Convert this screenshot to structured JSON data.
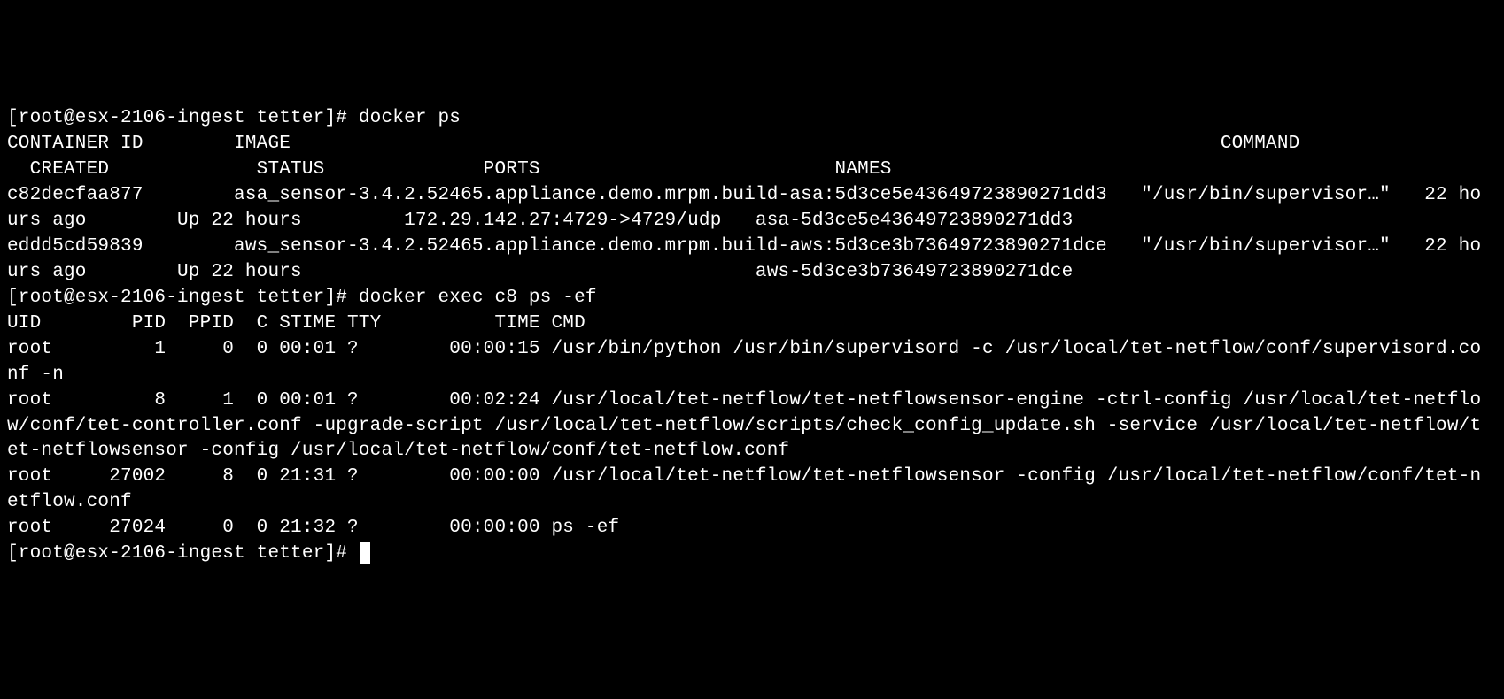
{
  "terminal": {
    "prompt1_open": "[",
    "prompt1_text": "[root@esx-2106-ingest tetter]# ",
    "cmd1": "docker ps",
    "header_line": "CONTAINER ID        IMAGE                                                                                  COMMAND                  CREATED             STATUS              PORTS                          NAMES",
    "row1": "c82decfaa877        asa_sensor-3.4.2.52465.appliance.demo.mrpm.build-asa:5d3ce5e43649723890271dd3   \"/usr/bin/supervisor…\"   22 hours ago        Up 22 hours         172.29.142.27:4729->4729/udp   asa-5d3ce5e43649723890271dd3",
    "row2": "eddd5cd59839        aws_sensor-3.4.2.52465.appliance.demo.mrpm.build-aws:5d3ce3b73649723890271dce   \"/usr/bin/supervisor…\"   22 hours ago        Up 22 hours                                        aws-5d3ce3b73649723890271dce",
    "prompt2_text": "[root@esx-2106-ingest tetter]# ",
    "cmd2": "docker exec c8 ps -ef",
    "ps_header": "UID        PID  PPID  C STIME TTY          TIME CMD",
    "ps_row1": "root         1     0  0 00:01 ?        00:00:15 /usr/bin/python /usr/bin/supervisord -c /usr/local/tet-netflow/conf/supervisord.conf -n",
    "ps_row2": "root         8     1  0 00:01 ?        00:02:24 /usr/local/tet-netflow/tet-netflowsensor-engine -ctrl-config /usr/local/tet-netflow/conf/tet-controller.conf -upgrade-script /usr/local/tet-netflow/scripts/check_config_update.sh -service /usr/local/tet-netflow/tet-netflowsensor -config /usr/local/tet-netflow/conf/tet-netflow.conf",
    "ps_row3": "root     27002     8  0 21:31 ?        00:00:00 /usr/local/tet-netflow/tet-netflowsensor -config /usr/local/tet-netflow/conf/tet-netflow.conf",
    "ps_row4": "root     27024     0  0 21:32 ?        00:00:00 ps -ef",
    "prompt3_text": "[root@esx-2106-ingest tetter]# "
  }
}
